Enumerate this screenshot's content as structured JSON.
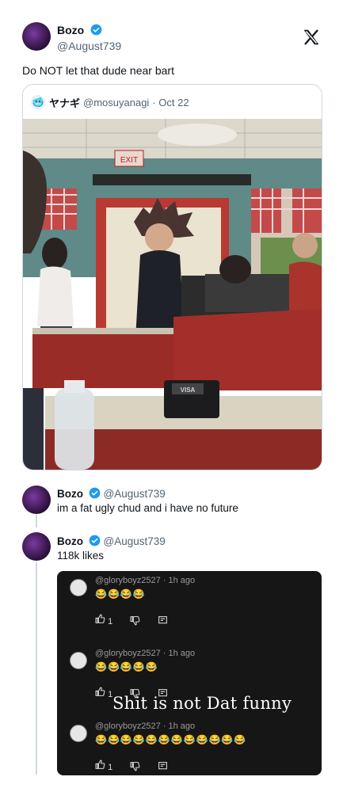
{
  "header": {
    "name": "Bozo",
    "handle": "@August739",
    "x_logo": "X"
  },
  "tweet": {
    "text": "Do NOT let that dude near bart"
  },
  "quote": {
    "avatar_glyph": "🥶",
    "name": "ヤナギ",
    "handle": "@mosuyanagi",
    "date": "· Oct 22",
    "photo_labels": {
      "exit_sign": "EXIT",
      "card_reader": "VISA"
    }
  },
  "replies": [
    {
      "name": "Bozo",
      "handle": "@August739",
      "text": "im a fat ugly chud and i have no future"
    },
    {
      "name": "Bozo",
      "handle": "@August739",
      "text": "118k likes"
    }
  ],
  "comments": [
    {
      "user": "@gloryboyz2527 · 1h ago",
      "emojis": "😂😂😂😂",
      "likes": "1"
    },
    {
      "user": "@gloryboyz2527 · 1h ago",
      "emojis": "😂😂😂😂😂",
      "likes": "1"
    },
    {
      "user": "@gloryboyz2527 · 1h ago",
      "emojis": "😂😂😂😂😂😂😂😂😂😂😂😂",
      "likes": "1"
    }
  ],
  "overlay_caption": "Shit is not Dat funny",
  "colors": {
    "verified": "#1d9bf0",
    "border": "#cfd9de",
    "secondary_text": "#536471",
    "comment_bg": "#161616"
  }
}
